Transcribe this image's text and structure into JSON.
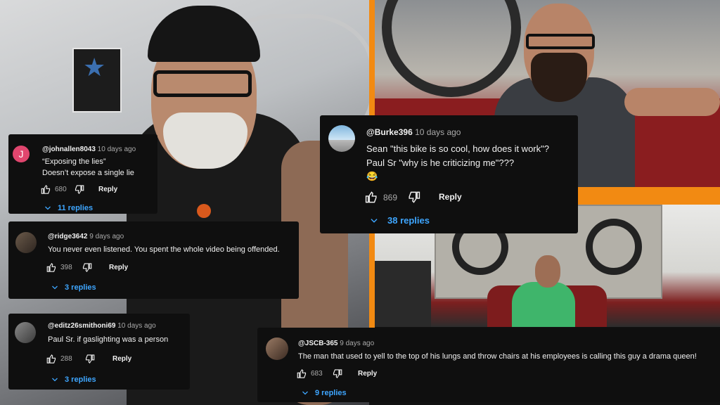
{
  "colors": {
    "accent_orange": "#f28a12",
    "comment_bg": "#0f0f0f",
    "link_blue": "#3ea6ff",
    "meta_gray": "#aaaaaa"
  },
  "comments": [
    {
      "handle": "@johnallen8043",
      "time": "10 days ago",
      "lines": [
        "“Exposing the lies”",
        "Doesn’t expose a single lie"
      ],
      "avatar_letter": "J",
      "likes": "680",
      "reply_label": "Reply",
      "replies": "11 replies"
    },
    {
      "handle": "@ridge3642",
      "time": "9 days ago",
      "lines": [
        "You never even listened. You spent the whole video being offended."
      ],
      "likes": "398",
      "reply_label": "Reply",
      "replies": "3 replies"
    },
    {
      "handle": "@editz26smithoni69",
      "time": "10 days ago",
      "lines": [
        "Paul Sr. if gaslighting was a person"
      ],
      "likes": "288",
      "reply_label": "Reply",
      "replies": "3 replies"
    },
    {
      "handle": "@Burke396",
      "time": "10 days ago",
      "lines": [
        "Sean \"this bike is so cool, how does it work\"?",
        "Paul Sr \"why is he criticizing me\"???",
        "😂"
      ],
      "likes": "869",
      "reply_label": "Reply",
      "replies": "38 replies"
    },
    {
      "handle": "@JSCB-365",
      "time": "9 days ago",
      "lines": [
        "The man that used to yell to the top of his lungs and throw chairs at his employees is calling this guy a drama queen!"
      ],
      "likes": "683",
      "reply_label": "Reply",
      "replies": "9 replies"
    }
  ]
}
